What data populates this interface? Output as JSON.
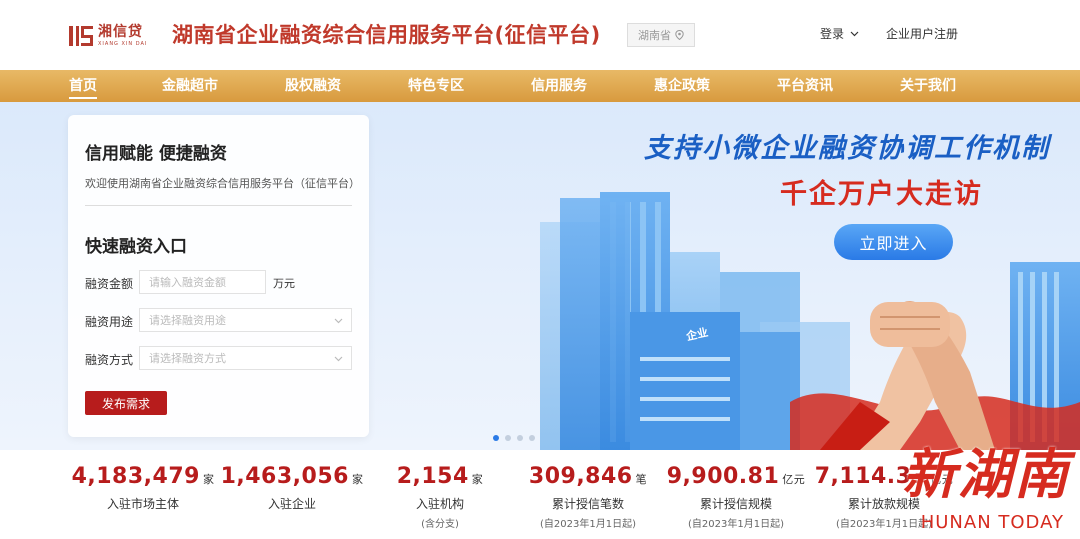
{
  "header": {
    "logo_cn": "湘信贷",
    "logo_en": "XIANG XIN DAI",
    "title": "湖南省企业融资综合信用服务平台(征信平台)",
    "region": "湖南省",
    "login": "登录",
    "register": "企业用户注册"
  },
  "nav": [
    "首页",
    "金融超市",
    "股权融资",
    "特色专区",
    "信用服务",
    "惠企政策",
    "平台资讯",
    "关于我们"
  ],
  "banner": {
    "slogan1": "支持小微企业融资协调工作机制",
    "slogan2": "千企万户大走访",
    "enter": "立即进入",
    "building_sign": "企业"
  },
  "card": {
    "title": "信用赋能 便捷融资",
    "welcome": "欢迎使用湖南省企业融资综合信用服务平台（征信平台）",
    "entry_title": "快速融资入口",
    "amount_label": "融资金额",
    "amount_placeholder": "请输入融资金额",
    "amount_unit": "万元",
    "purpose_label": "融资用途",
    "purpose_placeholder": "请选择融资用途",
    "method_label": "融资方式",
    "method_placeholder": "请选择融资方式",
    "submit": "发布需求"
  },
  "stats": [
    {
      "num": "4,183,479",
      "unit": "家",
      "label": "入驻市场主体",
      "sub": ""
    },
    {
      "num": "1,463,056",
      "unit": "家",
      "label": "入驻企业",
      "sub": ""
    },
    {
      "num": "2,154",
      "unit": "家",
      "label": "入驻机构",
      "sub": "(含分支)"
    },
    {
      "num": "309,846",
      "unit": "笔",
      "label": "累计授信笔数",
      "sub": "(自2023年1月1日起)"
    },
    {
      "num": "9,900.81",
      "unit": "亿元",
      "label": "累计授信规模",
      "sub": "(自2023年1月1日起)"
    },
    {
      "num": "7,114.33",
      "unit": "亿元",
      "label": "累计放款规模",
      "sub": "(自2023年1月1日起)"
    }
  ],
  "watermark": {
    "cn": "新湖南",
    "en": "HUNAN TODAY"
  },
  "colors": {
    "brand_red": "#b71c1c",
    "nav_gold": "#d89a3e",
    "accent_blue": "#2a7ae6"
  }
}
